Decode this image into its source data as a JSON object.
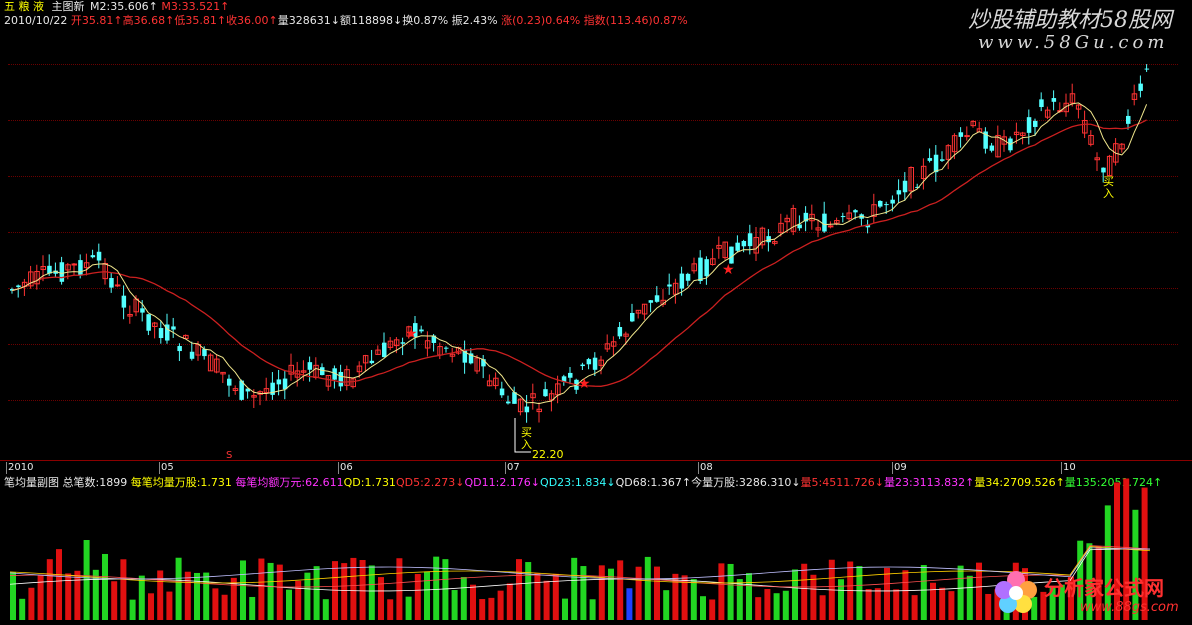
{
  "header": {
    "stock_name": "五 粮 液",
    "main_chart": "主图新",
    "m2": "M2:35.606↑",
    "m3": "M3:33.521↑",
    "date": "2010/10/22",
    "open": "开35.81↑",
    "high": "高36.68↑",
    "low": "低35.81↑",
    "close": "收36.00↑",
    "volume": "量328631↓",
    "amount": "额118898↓",
    "turnover": "换0.87%",
    "amplitude": "振2.43%",
    "change": "涨(0.23)0.64%",
    "index": "指数(113.46)0.87%"
  },
  "watermark": {
    "title": "炒股辅助教材58股网",
    "url": "www.58Gu.com"
  },
  "x_axis": {
    "labels": [
      "2010",
      "05",
      "06",
      "07",
      "08",
      "09",
      "10"
    ]
  },
  "markers": {
    "low_value": "22.20",
    "buy1": "买",
    "buy1b": "入",
    "buy2": "买",
    "buy2b": "入",
    "s_mark": "S"
  },
  "sub_header": {
    "title": "笔均量副图",
    "total": "总笔数:1899",
    "avg": "每笔均量万股:1.731",
    "avg_amount": "每笔均额万元:62.611",
    "qd": "QD:1.731",
    "qd5": "QD5:2.273↓",
    "qd11": "QD11:2.176↓",
    "qd23": "QD23:1.834↓",
    "qd68": "QD68:1.367↑",
    "today": "今量万股:3286.310↓",
    "l5": "量5:4511.726↓",
    "l23": "量23:3113.832↑",
    "l34": "量34:2709.526↑",
    "l135": "量135:2051.724↑"
  },
  "logo": {
    "text": "分析家公式网",
    "url": "www.88gs.com"
  },
  "colors": {
    "up": "#ff3333",
    "down": "#54ffff",
    "ma_short": "#f0e68c",
    "ma_long": "#cc2020",
    "vol_up": "#e01010",
    "vol_down": "#22d622",
    "grid": "#8a0000"
  }
}
